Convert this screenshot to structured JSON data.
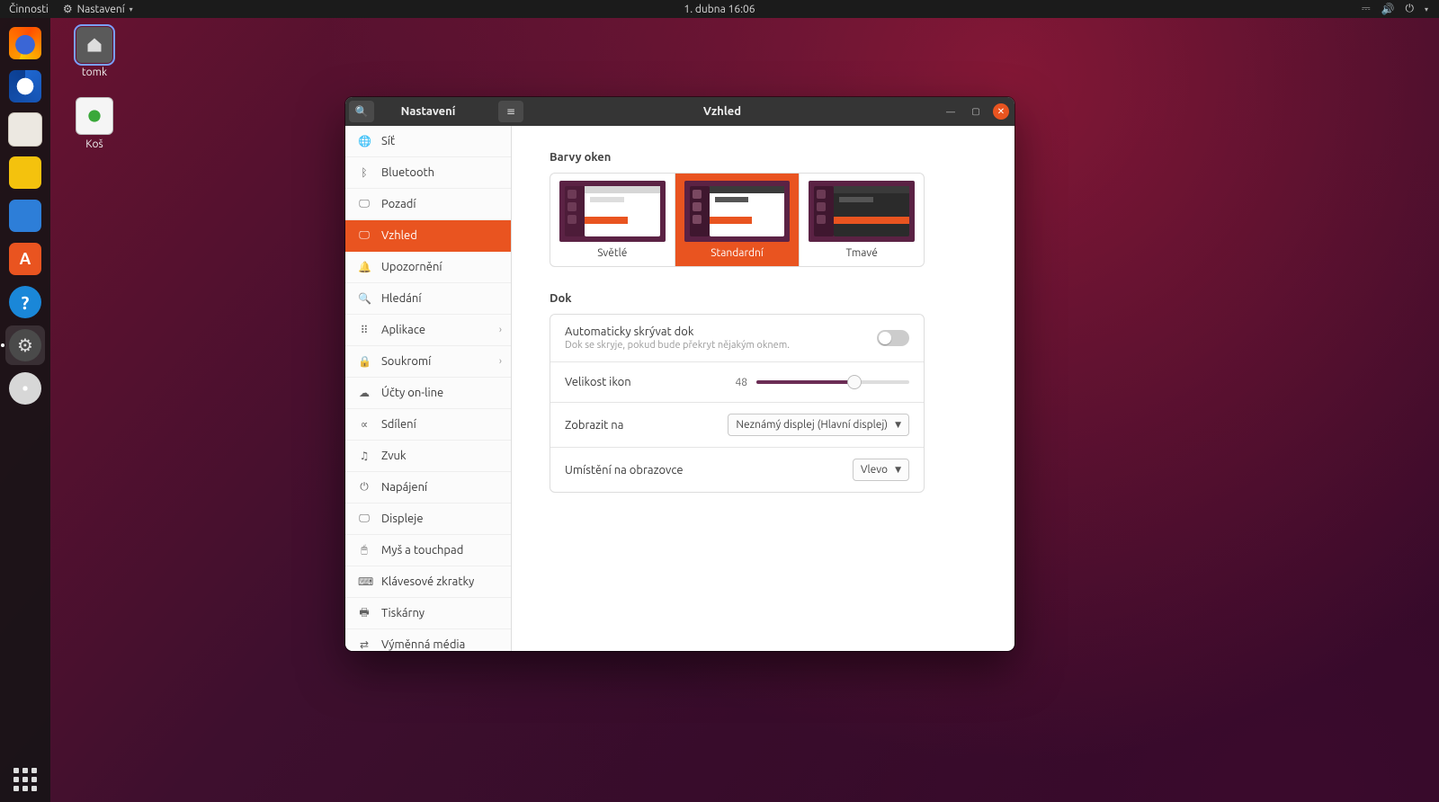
{
  "topbar": {
    "activities": "Činnosti",
    "appmenu": "Nastavení",
    "datetime": "1. dubna  16:06"
  },
  "desktop": {
    "home_label": "tomk",
    "trash_label": "Koš"
  },
  "window": {
    "app_title": "Nastavení",
    "page_title": "Vzhled"
  },
  "sidebar": {
    "items": [
      {
        "icon": "🌐",
        "label": "Síť"
      },
      {
        "icon": "ᛒ",
        "label": "Bluetooth"
      },
      {
        "icon": "🖵",
        "label": "Pozadí"
      },
      {
        "icon": "🖵",
        "label": "Vzhled",
        "selected": true
      },
      {
        "icon": "🔔",
        "label": "Upozornění"
      },
      {
        "icon": "🔍",
        "label": "Hledání"
      },
      {
        "icon": "⠿",
        "label": "Aplikace",
        "chev": true
      },
      {
        "icon": "🔒",
        "label": "Soukromí",
        "chev": true
      },
      {
        "icon": "☁",
        "label": "Účty on-line"
      },
      {
        "icon": "∝",
        "label": "Sdílení"
      },
      {
        "icon": "♫",
        "label": "Zvuk"
      },
      {
        "icon": "⏻",
        "label": "Napájení"
      },
      {
        "icon": "🖵",
        "label": "Displeje"
      },
      {
        "icon": "🖱",
        "label": "Myš a touchpad"
      },
      {
        "icon": "⌨",
        "label": "Klávesové zkratky"
      },
      {
        "icon": "🖶",
        "label": "Tiskárny"
      },
      {
        "icon": "⇄",
        "label": "Výměnná média"
      }
    ]
  },
  "appearance": {
    "window_colors_title": "Barvy oken",
    "themes": {
      "light": "Světlé",
      "standard": "Standardní",
      "dark": "Tmavé"
    },
    "dock_title": "Dok",
    "autohide_label": "Automaticky skrývat dok",
    "autohide_sub": "Dok se skryje, pokud bude překryt nějakým oknem.",
    "autohide_on": false,
    "iconsize_label": "Velikost ikon",
    "iconsize_value": "48",
    "show_on_label": "Zobrazit na",
    "show_on_value": "Neznámý displej (Hlavní displej)",
    "position_label": "Umístění na obrazovce",
    "position_value": "Vlevo"
  }
}
